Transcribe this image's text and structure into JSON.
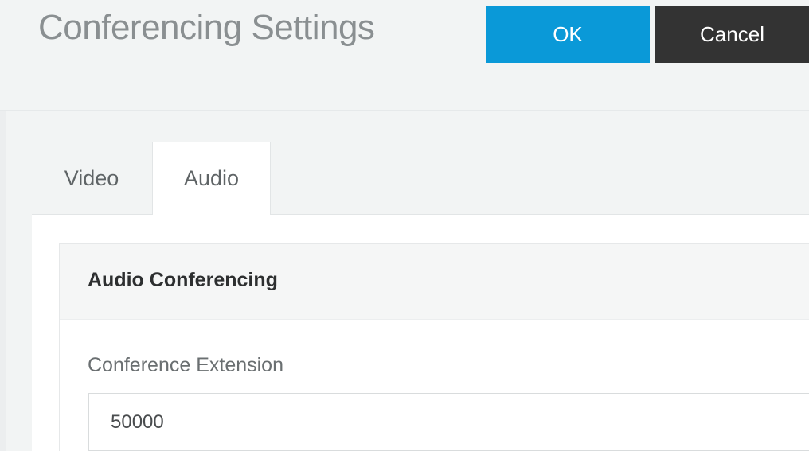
{
  "header": {
    "title": "Conferencing Settings",
    "ok_label": "OK",
    "cancel_label": "Cancel"
  },
  "tabs": [
    {
      "label": "Video",
      "active": false
    },
    {
      "label": "Audio",
      "active": true
    }
  ],
  "panel": {
    "heading": "Audio Conferencing",
    "fields": [
      {
        "label": "Conference Extension",
        "value": "50000"
      }
    ]
  },
  "colors": {
    "accent": "#0a99d8",
    "cancel": "#333333",
    "background": "#f2f4f4"
  }
}
